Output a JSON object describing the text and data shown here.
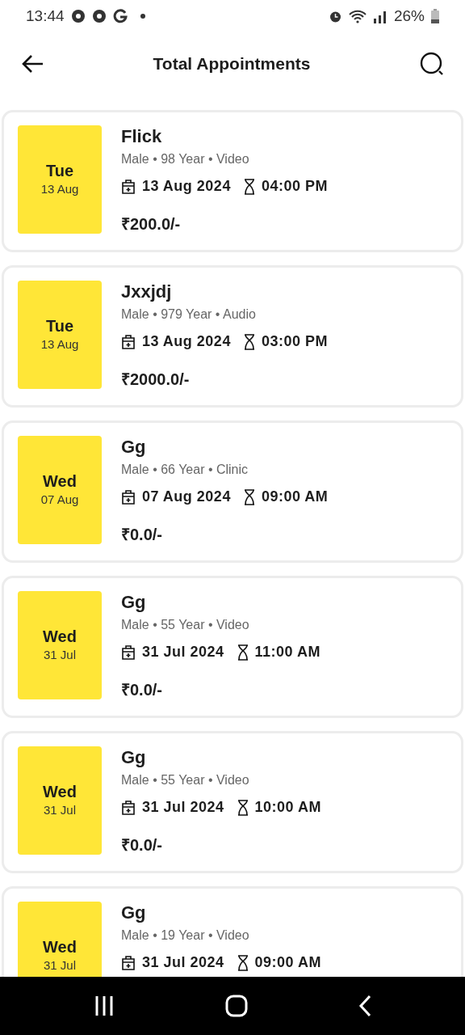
{
  "status_bar": {
    "time": "13:44",
    "battery": "26%"
  },
  "header": {
    "title": "Total Appointments"
  },
  "appointments": [
    {
      "day": "Tue",
      "date_short": "13 Aug",
      "name": "Flick",
      "details": "Male • 98 Year • Video",
      "date": "13 Aug 2024",
      "time": "04:00 PM",
      "fee": "₹200.0/-"
    },
    {
      "day": "Tue",
      "date_short": "13 Aug",
      "name": "Jxxjdj",
      "details": "Male • 979 Year • Audio",
      "date": "13 Aug 2024",
      "time": "03:00 PM",
      "fee": "₹2000.0/-"
    },
    {
      "day": "Wed",
      "date_short": "07 Aug",
      "name": "Gg",
      "details": "Male • 66 Year • Clinic",
      "date": "07 Aug 2024",
      "time": "09:00 AM",
      "fee": "₹0.0/-"
    },
    {
      "day": "Wed",
      "date_short": "31 Jul",
      "name": "Gg",
      "details": "Male • 55 Year • Video",
      "date": "31 Jul 2024",
      "time": "11:00 AM",
      "fee": "₹0.0/-"
    },
    {
      "day": "Wed",
      "date_short": "31 Jul",
      "name": "Gg",
      "details": "Male • 55 Year • Video",
      "date": "31 Jul 2024",
      "time": "10:00 AM",
      "fee": "₹0.0/-"
    },
    {
      "day": "Wed",
      "date_short": "31 Jul",
      "name": "Gg",
      "details": "Male • 19 Year • Video",
      "date": "31 Jul 2024",
      "time": "09:00 AM"
    }
  ]
}
